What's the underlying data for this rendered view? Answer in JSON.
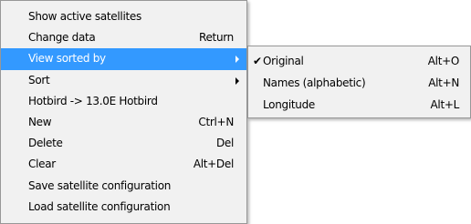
{
  "main_menu": {
    "items": [
      {
        "label": "Show active satellites",
        "shortcut": ""
      },
      {
        "label": "Change data",
        "shortcut": "Return"
      },
      {
        "label": "View sorted by",
        "shortcut": ""
      },
      {
        "label": "Sort",
        "shortcut": ""
      },
      {
        "label": "Hotbird -> 13.0E Hotbird",
        "shortcut": ""
      },
      {
        "label": "New",
        "shortcut": "Ctrl+N"
      },
      {
        "label": "Delete",
        "shortcut": "Del"
      },
      {
        "label": "Clear",
        "shortcut": "Alt+Del"
      },
      {
        "label": "Save satellite configuration",
        "shortcut": ""
      },
      {
        "label": "Load satellite configuration",
        "shortcut": ""
      }
    ]
  },
  "sub_menu": {
    "items": [
      {
        "label": "Original",
        "shortcut": "Alt+O",
        "check": "✔"
      },
      {
        "label": "Names (alphabetic)",
        "shortcut": "Alt+N"
      },
      {
        "label": "Longitude",
        "shortcut": "Alt+L"
      }
    ]
  },
  "colors": {
    "highlight": "#3399ff",
    "menu_bg": "#f1f1f1",
    "border": "#979797"
  }
}
